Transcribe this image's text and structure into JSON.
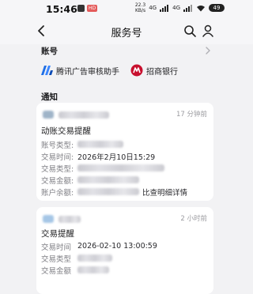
{
  "status_bar": {
    "time": "15:46",
    "hd_badge": "HD",
    "net_speed_value": "22.3",
    "net_speed_unit": "KB/s",
    "network": "4G",
    "network2": "4G",
    "battery": "49"
  },
  "nav": {
    "title": "服务号"
  },
  "accounts": {
    "heading": "账号",
    "items": [
      {
        "name": "腾讯广告审核助手"
      },
      {
        "name": "招商银行"
      }
    ]
  },
  "notifications": {
    "heading": "通知",
    "cards": [
      {
        "time": "17 分钟前",
        "title": "动账交易提醒",
        "rows": [
          {
            "label": "账号类型:",
            "value": ""
          },
          {
            "label": "交易时间:",
            "value": "2026年2月10日15:29"
          },
          {
            "label": "交易类型:",
            "value": ""
          },
          {
            "label": "交易金额:",
            "value": ""
          },
          {
            "label": "账户余额:",
            "value": "比查明细详情"
          }
        ]
      },
      {
        "time": "2 小时前",
        "title": "交易提醒",
        "rows": [
          {
            "label": "交易时间",
            "value": "2026-02-10 13:00:59"
          },
          {
            "label": "交易类型",
            "value": ""
          },
          {
            "label": "交易金额",
            "value": ""
          }
        ]
      }
    ]
  },
  "colors": {
    "background": "#f2f2f4",
    "card": "#ffffff",
    "muted_text": "#9b9ba0",
    "bank_red": "#c8102e",
    "tencent_blue": "#1f6fe5"
  }
}
